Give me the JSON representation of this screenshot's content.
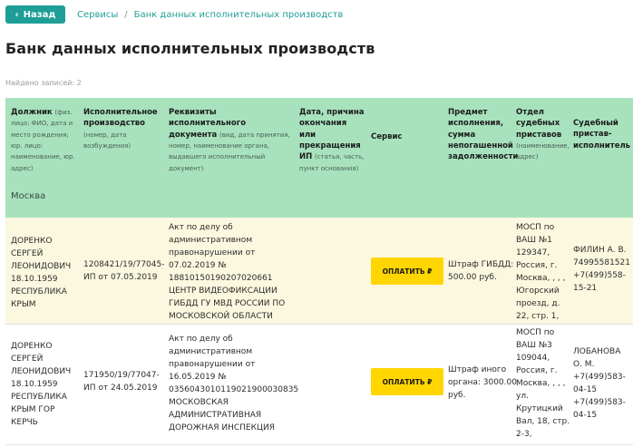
{
  "nav": {
    "back_label": "Назад",
    "crumb_1": "Сервисы",
    "separator": "/",
    "crumb_2": "Банк данных исполнительных производств"
  },
  "page": {
    "title": "Банк данных исполнительных производств",
    "found": "Найдено записей: 2"
  },
  "table": {
    "headers": {
      "debtor": "Должник",
      "debtor_sub": "(физ. лицо: ФИО, дата и место рождения; юр. лицо: наименование, юр. адрес)",
      "proceeding": "Исполнительное производство",
      "proceeding_sub": "(номер, дата возбуждения)",
      "doc": "Реквизиты исполнительного документа",
      "doc_sub": "(вид, дата принятия, номер, наименование органа, выдавшего исполнительный документ)",
      "end": "Дата, причина окончания или прекращения ИП",
      "end_sub": "(статья, часть, пункт основания)",
      "service": "Сервис",
      "subject": "Предмет исполнения, сумма непогашенной задолженности",
      "dept": "Отдел судебных приставов",
      "dept_sub": "(наименование, адрес)",
      "bailiff": "Судебный пристав-исполнитель"
    },
    "region": "Москва",
    "rows": [
      {
        "debtor": "ДОРЕНКО\nСЕРГЕЙ\nЛЕОНИДОВИЧ\n18.10.1959\nРЕСПУБЛИКА\nКРЫМ",
        "proceeding": "1208421/19/77045-\nИП от 07.05.2019",
        "doc": "Акт по делу об\nадминистративном\nправонарушении от\n07.02.2019 №\n18810150190207020661\nЦЕНТР ВИДЕОФИКСАЦИИ\nГИБДД ГУ МВД РОССИИ ПО\nМОСКОВСКОЙ ОБЛАСТИ",
        "end": "",
        "pay_label": "ОПЛАТИТЬ ₽",
        "subject": "Штраф ГИБДД:\n500.00 руб.",
        "dept": "МОСП по\nВАШ №1\n129347,\nРоссия, г.\nМосква, , , ,\nЮгорский\nпроезд, д.\n22, стр. 1,",
        "bailiff": "ФИЛИН А. В.\n74995581521\n+7(499)558-\n15-21"
      },
      {
        "debtor": "ДОРЕНКО\nСЕРГЕЙ\nЛЕОНИДОВИЧ\n18.10.1959\nРЕСПУБЛИКА\nКРЫМ ГОР\nКЕРЧЬ",
        "proceeding": "171950/19/77047-\nИП от 24.05.2019",
        "doc": "Акт по делу об\nадминистративном\nправонарушении от\n16.05.2019 №\n0356043010119021900030835\nМОСКОВСКАЯ\nАДМИНИСТРАТИВНАЯ\nДОРОЖНАЯ ИНСПЕКЦИЯ",
        "end": "",
        "pay_label": "ОПЛАТИТЬ ₽",
        "subject": "Штраф иного\nоргана: 3000.00\nруб.",
        "dept": "МОСП по\nВАШ №3\n109044,\nРоссия, г.\nМосква, , , ,\nул.\nКрутицкий\nВал, 18, стр.\n2-3,",
        "bailiff": "ЛОБАНОВА\nО. М.\n+7(499)583-\n04-15\n+7(499)583-\n04-15"
      }
    ]
  }
}
